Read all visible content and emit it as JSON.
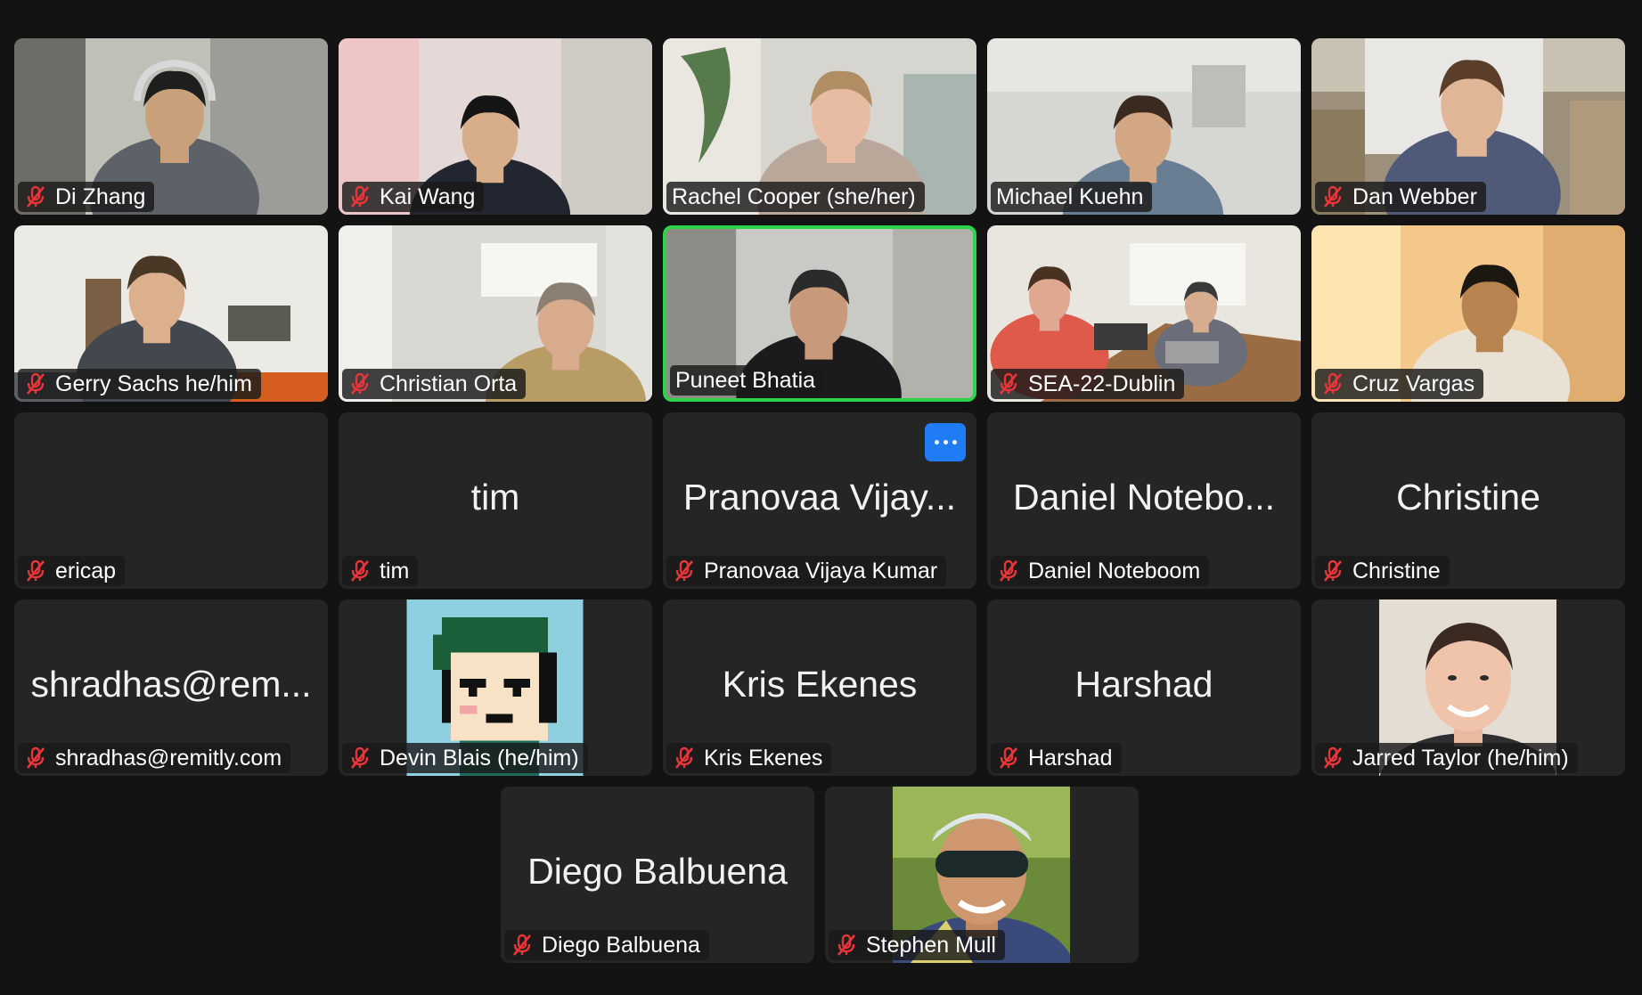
{
  "app": "Zoom meeting gallery view",
  "colors": {
    "background": "#131313",
    "tile": "#252525",
    "active_speaker_border": "#2fd34a",
    "muted_icon": "#e8353a",
    "more_button": "#1f7cf4"
  },
  "icons": {
    "muted": "microphone-muted-icon",
    "more": "more-options-icon"
  },
  "participants": [
    {
      "name": "Di Zhang",
      "muted": true,
      "video": true
    },
    {
      "name": "Kai Wang",
      "muted": true,
      "video": true
    },
    {
      "name": "Rachel Cooper (she/her)",
      "muted": false,
      "video": true
    },
    {
      "name": "Michael Kuehn",
      "muted": false,
      "video": true
    },
    {
      "name": "Dan Webber",
      "muted": true,
      "video": true
    },
    {
      "name": "Gerry Sachs he/him",
      "muted": true,
      "video": true
    },
    {
      "name": "Christian Orta",
      "muted": true,
      "video": true
    },
    {
      "name": "Puneet Bhatia",
      "muted": false,
      "video": true,
      "active_speaker": true
    },
    {
      "name": "SEA-22-Dublin",
      "muted": true,
      "video": true
    },
    {
      "name": "Cruz Vargas",
      "muted": true,
      "video": true
    },
    {
      "name": "ericap",
      "muted": true,
      "video": false,
      "display": ""
    },
    {
      "name": "tim",
      "muted": true,
      "video": false,
      "display": "tim"
    },
    {
      "name": "Pranovaa Vijaya Kumar",
      "muted": true,
      "video": false,
      "display": "Pranovaa Vijay...",
      "hovered_menu": true
    },
    {
      "name": "Daniel Noteboom",
      "muted": true,
      "video": false,
      "display": "Daniel Notebo..."
    },
    {
      "name": "Christine",
      "muted": true,
      "video": false,
      "display": "Christine"
    },
    {
      "name": "shradhas@remitly.com",
      "muted": true,
      "video": false,
      "display": "shradhas@rem..."
    },
    {
      "name": "Devin Blais (he/him)",
      "muted": true,
      "video": false,
      "picture": "pixel-art-avatar"
    },
    {
      "name": "Kris Ekenes",
      "muted": true,
      "video": false,
      "display": "Kris Ekenes"
    },
    {
      "name": "Harshad",
      "muted": true,
      "video": false,
      "display": "Harshad"
    },
    {
      "name": "Jarred Taylor (he/him)",
      "muted": true,
      "video": false,
      "picture": "profile-photo"
    },
    {
      "name": "Diego Balbuena",
      "muted": true,
      "video": false,
      "display": "Diego Balbuena"
    },
    {
      "name": "Stephen Mull",
      "muted": true,
      "video": false,
      "picture": "profile-photo"
    }
  ]
}
